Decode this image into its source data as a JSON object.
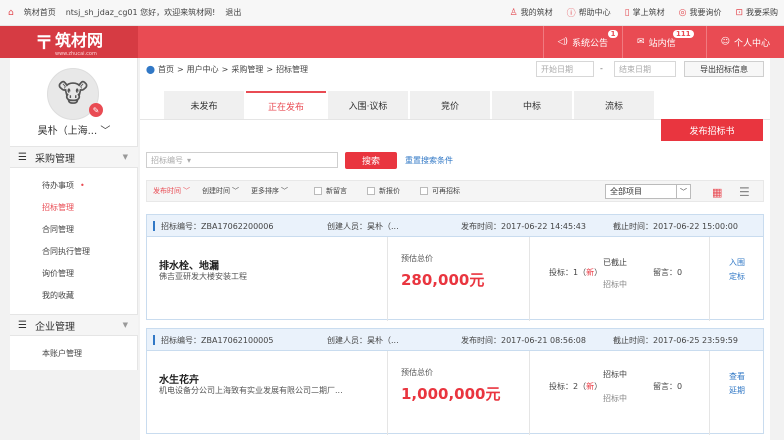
{
  "topbar": {
    "home_link": "筑材首页",
    "greeting": "ntsj_sh_jdaz_cg01 您好，欢迎来筑材网!",
    "logout": "退出",
    "right_links": [
      "我的筑材",
      "帮助中心",
      "掌上筑材",
      "我要询价",
      "我要采购"
    ]
  },
  "header": {
    "logo_text": "筑材网",
    "logo_sub": "www.zhucai.com",
    "items": [
      {
        "label": "系统公告",
        "badge": "1"
      },
      {
        "label": "站内信",
        "badge": "111"
      },
      {
        "label": "个人中心",
        "badge": ""
      }
    ]
  },
  "sidebar": {
    "user_name": "昊朴（上海...",
    "sections": [
      {
        "title": "采购管理",
        "items": [
          "待办事项",
          "招标管理",
          "合同管理",
          "合同执行管理",
          "询价管理",
          "我的收藏"
        ]
      },
      {
        "title": "企业管理",
        "items": [
          "本账户管理"
        ]
      }
    ],
    "active_item": "招标管理",
    "todo_dot": "•"
  },
  "breadcrumb": {
    "parts": [
      "首页",
      "用户中心",
      "采购管理",
      "招标管理"
    ],
    "sep": ">"
  },
  "dates": {
    "start_placeholder": "开始日期",
    "sep": "-",
    "end_placeholder": "结束日期"
  },
  "export_label": "导出招标信息",
  "tabs": [
    "未发布",
    "正在发布",
    "入围·议标",
    "竞价",
    "中标",
    "流标"
  ],
  "active_tab": "正在发布",
  "publish_label": "发布招标书",
  "search": {
    "placeholder": "招标编号",
    "button": "搜索",
    "reset": "重置搜索条件"
  },
  "filters": {
    "sorts": [
      "发布时间",
      "创建时间",
      "更多排序"
    ],
    "checks": [
      "新留言",
      "新报价",
      "可再招标"
    ],
    "select_value": "全部项目"
  },
  "cards": [
    {
      "code": "招标编号：ZBA17062200006",
      "creator": "创建人员：昊朴（...",
      "publish_time": "发布时间：2017-06-22 14:45:43",
      "deadline": "截止时间：2017-06-22 15:00:00",
      "name": "排水栓、地漏",
      "company": "佛吉亚研发大楼安装工程",
      "price_label": "预估总价",
      "price": "280,000元",
      "status_top": "已截止",
      "bid_prefix": "投标：1（",
      "bid_new": "新",
      "bid_suffix": "）",
      "status_bottom": "招标中",
      "message": "留言：0",
      "actions": [
        "入围",
        "定标"
      ]
    },
    {
      "code": "招标编号：ZBA17062100005",
      "creator": "创建人员：昊朴（...",
      "publish_time": "发布时间：2017-06-21 08:56:08",
      "deadline": "截止时间：2017-06-25 23:59:59",
      "name": "水生花卉",
      "company": "机电设备分公司上海致有实业发展有限公司二期厂...",
      "price_label": "预估总价",
      "price": "1,000,000元",
      "status_top": "招标中",
      "bid_prefix": "投标：2（",
      "bid_new": "新",
      "bid_suffix": "）",
      "status_bottom": "招标中",
      "message": "留言：0",
      "actions": [
        "查看",
        "延期"
      ]
    }
  ]
}
